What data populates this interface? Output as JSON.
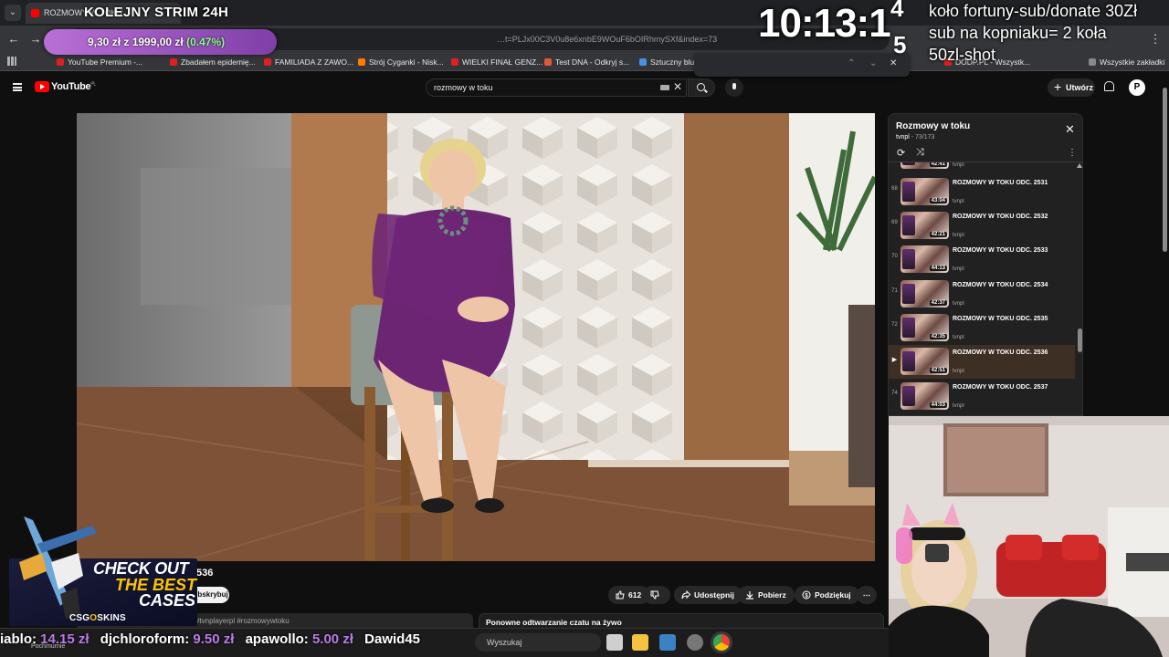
{
  "browser": {
    "tab_title": "ROZMOWY W TOKU",
    "url_visible": "…t=PLJx00C3V0u8e6xnbE9WOuF6bOIRhmySXf&index=73",
    "bookmarks": [
      {
        "label": "YouTube Premium -...",
        "color": "#e02020"
      },
      {
        "label": "Zbadałem epidemię...",
        "color": "#e02020"
      },
      {
        "label": "FAMILIADA Z ZAWO...",
        "color": "#e02020"
      },
      {
        "label": "Strój Cyganki - Nisk...",
        "color": "#ff7a00"
      },
      {
        "label": "WIELKI FINAŁ GENZ...",
        "color": "#e02020"
      },
      {
        "label": "Test DNA - Odkryj s...",
        "color": "#e05a3a"
      },
      {
        "label": "Sztuczny blus",
        "color": "#4a90e2"
      }
    ],
    "bookmarks_right": [
      "DODP.PL - Wszystk...",
      "Wszystkie zakładki"
    ]
  },
  "overlay": {
    "stream_title": "KOLEJNY STRIM 24H",
    "donation_progress": "9,30 zł z 1999,00 zł",
    "donation_percent": "(0.47%)",
    "clock": "10:13:1",
    "clock_digit_a": "4",
    "clock_digit_b": "5",
    "wheel_line1": "koło fortuny-sub/donate 30Zł",
    "wheel_line2": "sub na kopniaku= 2 koła",
    "wheel_line3": "50zl-shot"
  },
  "youtube": {
    "logo_text": "YouTube",
    "region": "PL",
    "search_query": "rozmowy w toku",
    "create_label": "Utwórz",
    "avatar_letter": "P"
  },
  "video": {
    "title_fragment": "536",
    "subscribe_label": "Subskrybuj",
    "likes": "612",
    "share_label": "Udostępnij",
    "download_label": "Pobierz",
    "thanks_label": "Podziękuj",
    "description_tags": "#tvnplayerpl #rozmowywtoku",
    "chat_replay_label": "Ponowne odtwarzanie czatu na żywo"
  },
  "playlist": {
    "title": "Rozmowy w toku",
    "channel": "tvnpl",
    "position": "73/173",
    "items": [
      {
        "num": "",
        "title": "",
        "duration": "42:41",
        "channel": "tvnpl",
        "active": false
      },
      {
        "num": "68",
        "title": "ROZMOWY W TOKU ODC. 2531",
        "duration": "43:04",
        "channel": "tvnpl",
        "active": false
      },
      {
        "num": "69",
        "title": "ROZMOWY W TOKU ODC. 2532",
        "duration": "42:21",
        "channel": "tvnpl",
        "active": false
      },
      {
        "num": "70",
        "title": "ROZMOWY W TOKU ODC. 2533",
        "duration": "44:13",
        "channel": "tvnpl",
        "active": false
      },
      {
        "num": "71",
        "title": "ROZMOWY W TOKU ODC. 2534",
        "duration": "42:37",
        "channel": "tvnpl",
        "active": false
      },
      {
        "num": "72",
        "title": "ROZMOWY W TOKU ODC. 2535",
        "duration": "42:35",
        "channel": "tvnpl",
        "active": false
      },
      {
        "num": "▶",
        "title": "ROZMOWY W TOKU ODC. 2536",
        "duration": "42:51",
        "channel": "tvnpl",
        "active": true
      },
      {
        "num": "74",
        "title": "ROZMOWY W TOKU ODC. 2537",
        "duration": "44:03",
        "channel": "tvnpl",
        "active": false
      }
    ]
  },
  "ad": {
    "line1": "CHECK OUT",
    "line2": "THE BEST",
    "line3": "CASES",
    "brand_a": "CSG",
    "brand_o": "O",
    "brand_b": "SKINS"
  },
  "ticker": [
    {
      "name": "iablo:",
      "amount": "14.15 zł"
    },
    {
      "name": "djchloroform:",
      "amount": "9.50 zł"
    },
    {
      "name": "apawollo:",
      "amount": "5.00 zł"
    },
    {
      "name": "Dawid45",
      "amount": ""
    }
  ],
  "taskbar": {
    "weather": "Pochmurnie",
    "search_placeholder": "Wyszukaj"
  },
  "colors": {
    "accent_youtube": "#ff0000",
    "donation_bar": "#b96fd6",
    "ticker_amount": "#b77ce9"
  }
}
